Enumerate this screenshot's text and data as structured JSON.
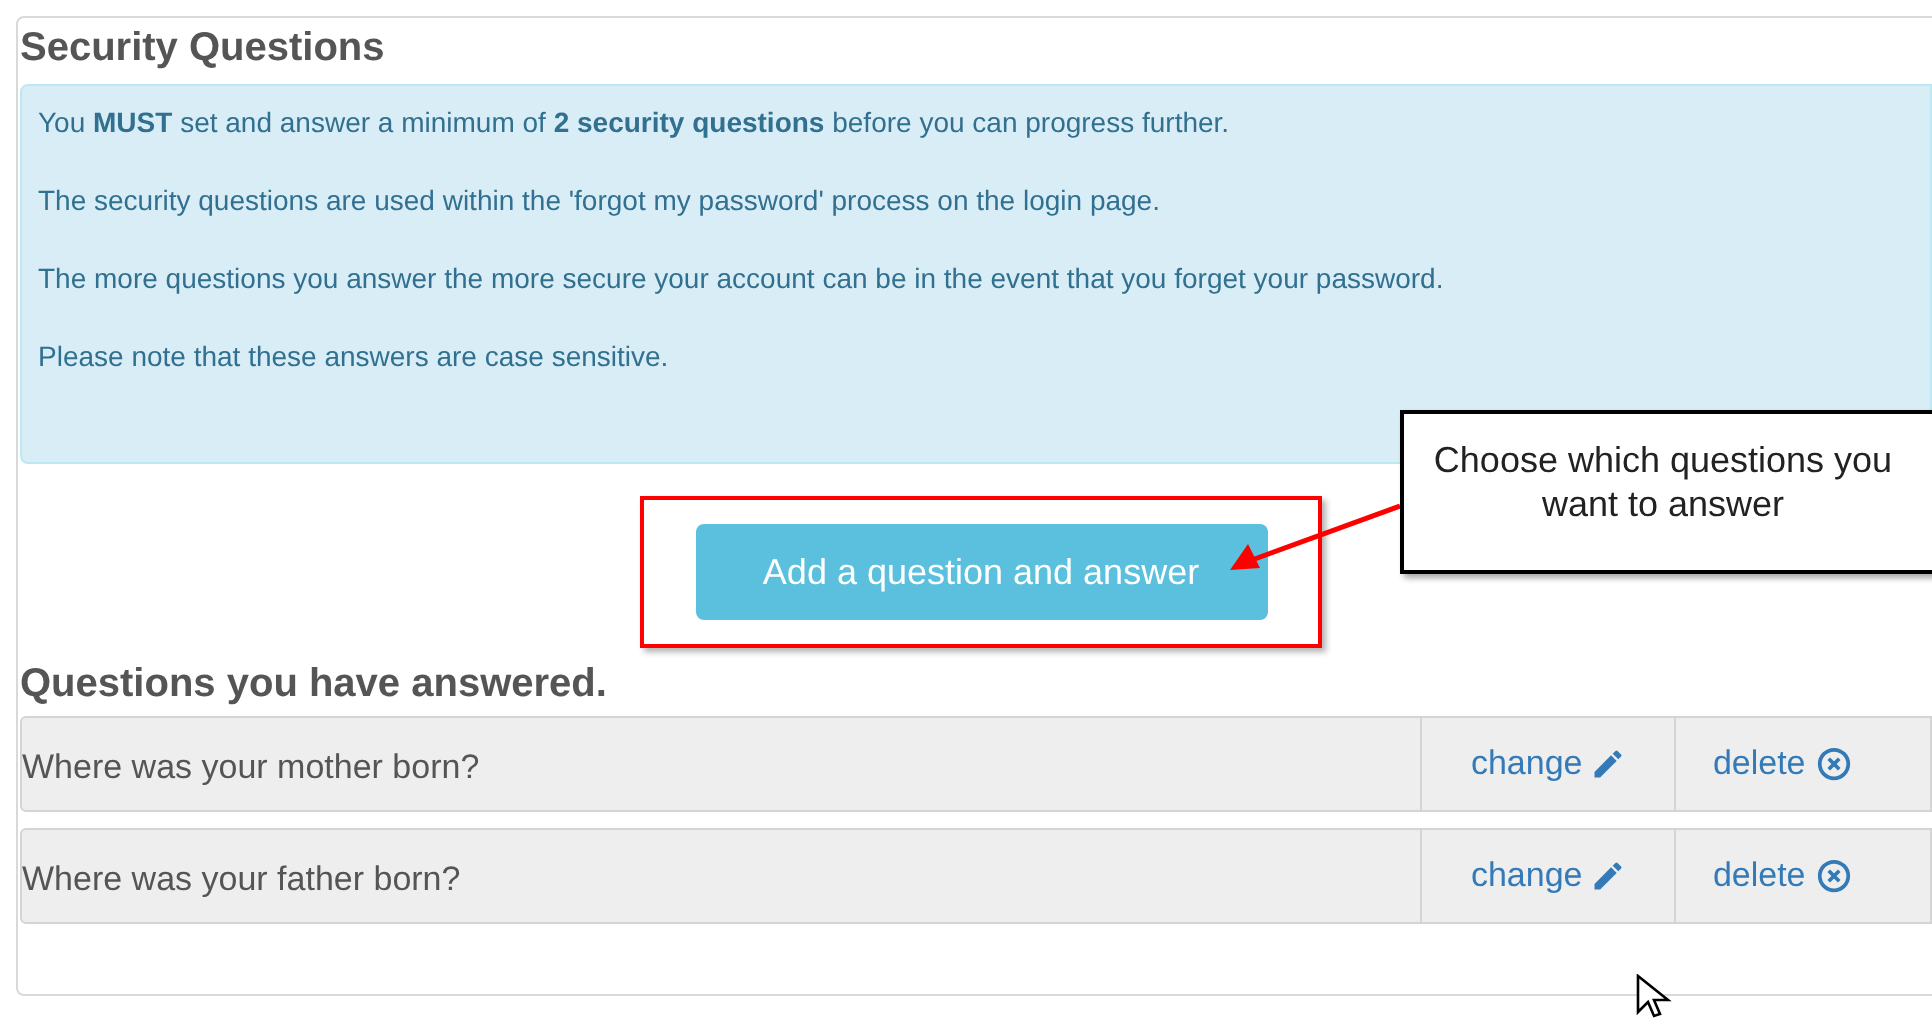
{
  "title": "Security Questions",
  "info": [
    "You **MUST** set and answer a minimum of **2 security questions** before you can progress further.",
    "The security questions are used within the 'forgot my password' process on the login page.",
    "The more questions you answer the more secure your account can be in the event that you forget your password.",
    "Please note that these answers are case sensitive."
  ],
  "add_button": "Add a question and answer",
  "callout": "Choose which questions you want to answer",
  "answered_heading": "Questions you have answered.",
  "rows": [
    {
      "question": "Where was your mother born?",
      "change": "change",
      "delete": "delete"
    },
    {
      "question": "Where was your father born?",
      "change": "change",
      "delete": "delete"
    }
  ]
}
